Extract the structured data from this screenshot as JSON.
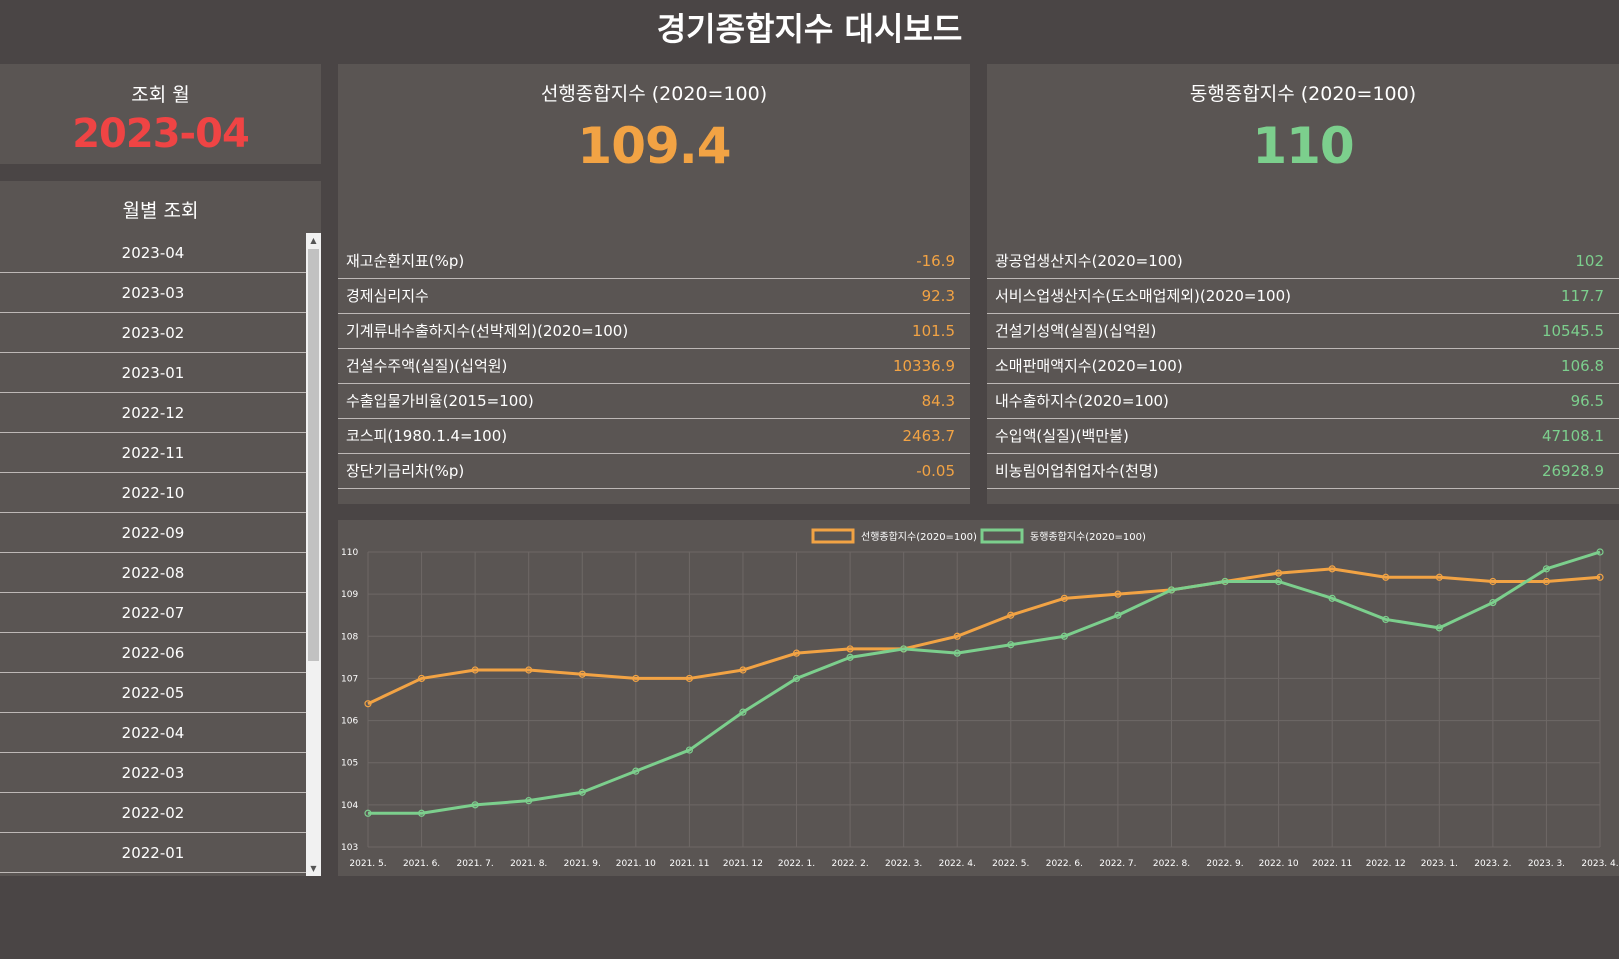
{
  "title": "경기종합지수 대시보드",
  "month_panel": {
    "label": "조회 월",
    "value": "2023-04"
  },
  "month_list": {
    "label": "월별 조회",
    "items": [
      "2023-04",
      "2023-03",
      "2023-02",
      "2023-01",
      "2022-12",
      "2022-11",
      "2022-10",
      "2022-09",
      "2022-08",
      "2022-07",
      "2022-06",
      "2022-05",
      "2022-04",
      "2022-03",
      "2022-02",
      "2022-01"
    ]
  },
  "leading": {
    "title": "선행종합지수 (2020=100)",
    "value": "109.4",
    "rows": [
      {
        "label": "재고순환지표(%p)",
        "value": "-16.9"
      },
      {
        "label": "경제심리지수",
        "value": "92.3"
      },
      {
        "label": "기계류내수출하지수(선박제외)(2020=100)",
        "value": "101.5"
      },
      {
        "label": "건설수주액(실질)(십억원)",
        "value": "10336.9"
      },
      {
        "label": "수출입물가비율(2015=100)",
        "value": "84.3"
      },
      {
        "label": "코스피(1980.1.4=100)",
        "value": "2463.7"
      },
      {
        "label": "장단기금리차(%p)",
        "value": "-0.05"
      }
    ]
  },
  "coincident": {
    "title": "동행종합지수 (2020=100)",
    "value": "110",
    "rows": [
      {
        "label": "광공업생산지수(2020=100)",
        "value": "102"
      },
      {
        "label": "서비스업생산지수(도소매업제외)(2020=100)",
        "value": "117.7"
      },
      {
        "label": "건설기성액(실질)(십억원)",
        "value": "10545.5"
      },
      {
        "label": "소매판매액지수(2020=100)",
        "value": "106.8"
      },
      {
        "label": "내수출하지수(2020=100)",
        "value": "96.5"
      },
      {
        "label": "수입액(실질)(백만불)",
        "value": "47108.1"
      },
      {
        "label": "비농림어업취업자수(천명)",
        "value": "26928.9"
      }
    ]
  },
  "colors": {
    "leading": "#f2a344",
    "coincident": "#7ccf8d",
    "selected_month": "#ef4444",
    "background": "#4a4545",
    "panel": "#5a5553"
  },
  "chart_data": {
    "type": "line",
    "title": "",
    "xlabel": "",
    "ylabel": "",
    "categories": [
      "2021. 5.",
      "2021. 6.",
      "2021. 7.",
      "2021. 8.",
      "2021. 9.",
      "2021. 10",
      "2021. 11",
      "2021. 12",
      "2022. 1.",
      "2022. 2.",
      "2022. 3.",
      "2022. 4.",
      "2022. 5.",
      "2022. 6.",
      "2022. 7.",
      "2022. 8.",
      "2022. 9.",
      "2022. 10",
      "2022. 11",
      "2022. 12",
      "2023. 1.",
      "2023. 2.",
      "2023. 3.",
      "2023. 4."
    ],
    "series": [
      {
        "name": "선행종합지수(2020=100)",
        "color": "#f2a344",
        "values": [
          106.4,
          107.0,
          107.2,
          107.2,
          107.1,
          107.0,
          107.0,
          107.2,
          107.6,
          107.7,
          107.7,
          108.0,
          108.5,
          108.9,
          109.0,
          109.1,
          109.3,
          109.5,
          109.6,
          109.4,
          109.4,
          109.3,
          109.3,
          109.4
        ]
      },
      {
        "name": "동행종합지수(2020=100)",
        "color": "#7ccf8d",
        "values": [
          103.8,
          103.8,
          104.0,
          104.1,
          104.3,
          104.8,
          105.3,
          106.2,
          107.0,
          107.5,
          107.7,
          107.6,
          107.8,
          108.0,
          108.5,
          109.1,
          109.3,
          109.3,
          108.9,
          108.4,
          108.2,
          108.8,
          109.6,
          110.0
        ]
      }
    ],
    "ylim": [
      103,
      110
    ],
    "yticks": [
      103,
      104,
      105,
      106,
      107,
      108,
      109,
      110
    ],
    "grid": true,
    "legend": "top-center"
  }
}
